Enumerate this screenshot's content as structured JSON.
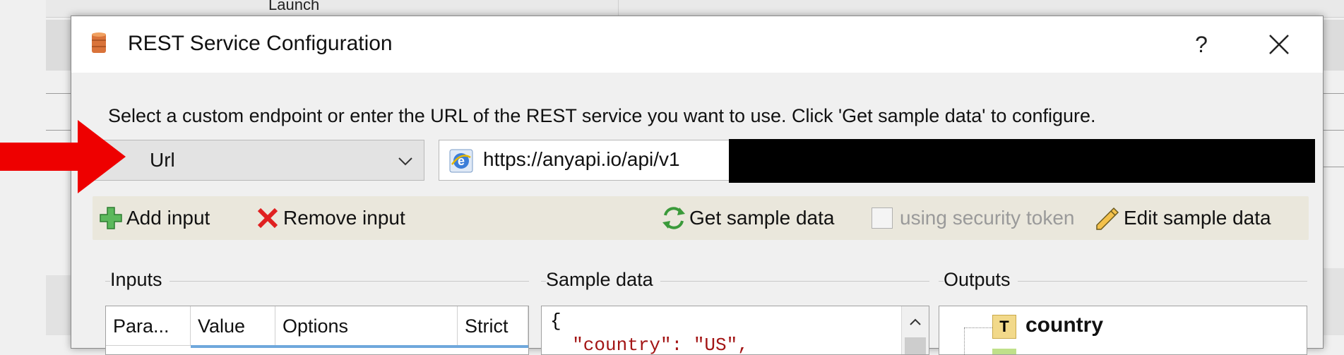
{
  "background": {
    "header_label": "Launch"
  },
  "dialog": {
    "title": "REST Service Configuration",
    "help_label": "?",
    "instruction": "Select a custom endpoint or enter the URL of the REST service you want to use. Click 'Get sample data' to configure.",
    "endpoint_type": {
      "selected": "Url"
    },
    "url": {
      "visible_value": "https://anyapi.io/api/v1",
      "redacted": true
    },
    "toolbar": {
      "add_input": "Add input",
      "remove_input": "Remove input",
      "get_sample_data": "Get sample data",
      "security_token": {
        "label": "using security token",
        "checked": false,
        "enabled": false
      },
      "edit_sample_data": "Edit sample data"
    },
    "inputs": {
      "group_label": "Inputs",
      "columns": [
        "Para...",
        "Value",
        "Options",
        "Strict"
      ]
    },
    "sample_data": {
      "group_label": "Sample data",
      "lines": [
        "{",
        "  \"country\": \"US\","
      ],
      "key_color": "#a31515"
    },
    "outputs": {
      "group_label": "Outputs",
      "items": [
        {
          "icon": "text-type-icon",
          "label": "country"
        },
        {
          "icon": "array-type-icon",
          "label": "..."
        }
      ]
    }
  },
  "annotation": {
    "arrow_color": "#ee0000"
  }
}
